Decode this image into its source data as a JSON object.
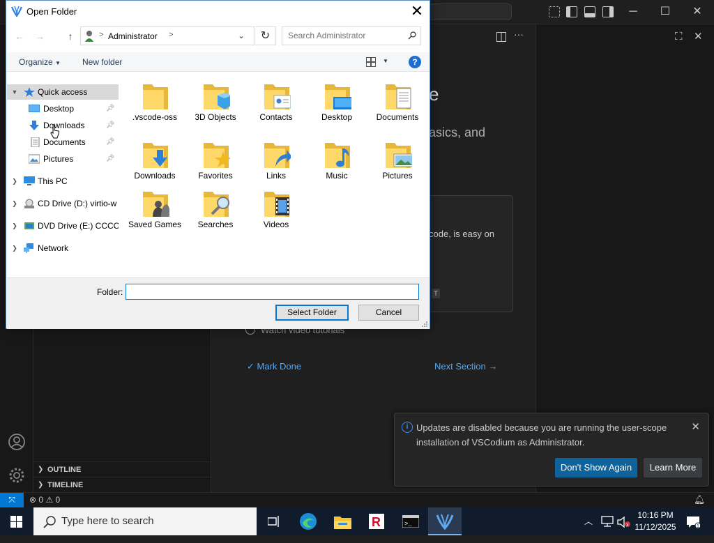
{
  "vscode": {
    "welcome": {
      "title_fragment": "e",
      "subtitle_fragment": "asics, and",
      "card_text": "code, is easy on",
      "kbd_hint": "T",
      "step_label": "Watch video tutorials",
      "mark_done": "Mark Done",
      "next_section": "Next Section →"
    },
    "sidebar": {
      "outline": "OUTLINE",
      "timeline": "TIMELINE"
    },
    "notification": {
      "message": "Updates are disabled because you are running the user-scope installation of VSCodium as Administrator.",
      "primary_button": "Don't Show Again",
      "secondary_button": "Learn More",
      "accent_color": "#0e639c"
    },
    "status": {
      "errors": "0",
      "warnings": "0"
    }
  },
  "dialog": {
    "title": "Open Folder",
    "address": {
      "breadcrumb": "Administrator"
    },
    "search_placeholder": "Search Administrator",
    "toolbar": {
      "organize": "Organize",
      "new_folder": "New folder"
    },
    "nav": [
      {
        "label": "Quick access",
        "icon": "star-icon",
        "selected": true
      },
      {
        "label": "Desktop",
        "icon": "desktop-icon",
        "pinned": true
      },
      {
        "label": "Downloads",
        "icon": "downloads-icon",
        "pinned": true
      },
      {
        "label": "Documents",
        "icon": "documents-icon",
        "pinned": true
      },
      {
        "label": "Pictures",
        "icon": "pictures-icon",
        "pinned": true
      },
      {
        "label": "This PC",
        "icon": "pc-icon"
      },
      {
        "label": "CD Drive (D:) virtio-w",
        "icon": "cd-drive-icon"
      },
      {
        "label": "DVD Drive (E:) CCCOI",
        "icon": "dvd-drive-icon"
      },
      {
        "label": "Network",
        "icon": "network-icon"
      }
    ],
    "items": [
      {
        "label": ".vscode-oss",
        "icon": "folder-icon"
      },
      {
        "label": "3D Objects",
        "icon": "folder-3d-objects-icon"
      },
      {
        "label": "Contacts",
        "icon": "folder-contacts-icon"
      },
      {
        "label": "Desktop",
        "icon": "folder-desktop-icon"
      },
      {
        "label": "Documents",
        "icon": "folder-documents-icon"
      },
      {
        "label": "Downloads",
        "icon": "folder-downloads-icon"
      },
      {
        "label": "Favorites",
        "icon": "folder-favorites-icon"
      },
      {
        "label": "Links",
        "icon": "folder-links-icon"
      },
      {
        "label": "Music",
        "icon": "folder-music-icon"
      },
      {
        "label": "Pictures",
        "icon": "folder-pictures-icon"
      },
      {
        "label": "Saved Games",
        "icon": "folder-saved-games-icon"
      },
      {
        "label": "Searches",
        "icon": "folder-searches-icon"
      },
      {
        "label": "Videos",
        "icon": "folder-videos-icon"
      }
    ],
    "folder_label": "Folder:",
    "folder_value": "",
    "select_button": "Select Folder",
    "cancel_button": "Cancel"
  },
  "taskbar": {
    "search_placeholder": "Type here to search",
    "time": "10:16 PM",
    "date": "11/12/2025"
  }
}
